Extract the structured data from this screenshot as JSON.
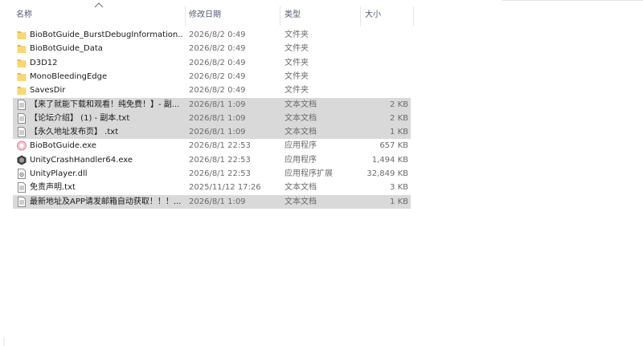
{
  "columns": {
    "name": "名称",
    "date": "修改日期",
    "type": "类型",
    "size": "大小"
  },
  "files": [
    {
      "name": "BioBotGuide_BurstDebugInformation...",
      "date": "2026/8/2 0:49",
      "type": "文件夹",
      "size": "",
      "icon": "folder-icon",
      "selected": false
    },
    {
      "name": "BioBotGuide_Data",
      "date": "2026/8/2 0:49",
      "type": "文件夹",
      "size": "",
      "icon": "folder-icon",
      "selected": false
    },
    {
      "name": "D3D12",
      "date": "2026/8/2 0:49",
      "type": "文件夹",
      "size": "",
      "icon": "folder-icon",
      "selected": false
    },
    {
      "name": "MonoBleedingEdge",
      "date": "2026/8/2 0:49",
      "type": "文件夹",
      "size": "",
      "icon": "folder-icon",
      "selected": false
    },
    {
      "name": "SavesDir",
      "date": "2026/8/2 0:49",
      "type": "文件夹",
      "size": "",
      "icon": "folder-icon",
      "selected": false
    },
    {
      "name": "【来了就能下载和观看！纯免费！】- 副...",
      "date": "2026/8/1 1:09",
      "type": "文本文档",
      "size": "2 KB",
      "icon": "text-file-icon",
      "selected": true
    },
    {
      "name": "【论坛介绍】 (1) - 副本.txt",
      "date": "2026/8/1 1:09",
      "type": "文本文档",
      "size": "2 KB",
      "icon": "text-file-icon",
      "selected": true
    },
    {
      "name": "【永久地址发布页】 .txt",
      "date": "2026/8/1 1:09",
      "type": "文本文档",
      "size": "1 KB",
      "icon": "text-file-icon",
      "selected": true
    },
    {
      "name": "BioBotGuide.exe",
      "date": "2026/8/1 22:53",
      "type": "应用程序",
      "size": "657 KB",
      "icon": "app-exe-icon",
      "selected": false
    },
    {
      "name": "UnityCrashHandler64.exe",
      "date": "2026/8/1 22:53",
      "type": "应用程序",
      "size": "1,494 KB",
      "icon": "unity-exe-icon",
      "selected": false
    },
    {
      "name": "UnityPlayer.dll",
      "date": "2026/8/1 22:53",
      "type": "应用程序扩展",
      "size": "32,849 KB",
      "icon": "dll-file-icon",
      "selected": false
    },
    {
      "name": "免责声明.txt",
      "date": "2025/11/12 17:26",
      "type": "文本文档",
      "size": "3 KB",
      "icon": "text-file-icon",
      "selected": false
    },
    {
      "name": "最新地址及APP请发邮箱自动获取！！！...",
      "date": "2026/8/1 1:09",
      "type": "文本文档",
      "size": "1 KB",
      "icon": "text-file-icon",
      "selected": true
    }
  ],
  "colors": {
    "folder": "#f8d775",
    "folder_dark": "#e8b84a",
    "selected_row": "#d9d9d9",
    "header_text": "#4d5a6e"
  }
}
